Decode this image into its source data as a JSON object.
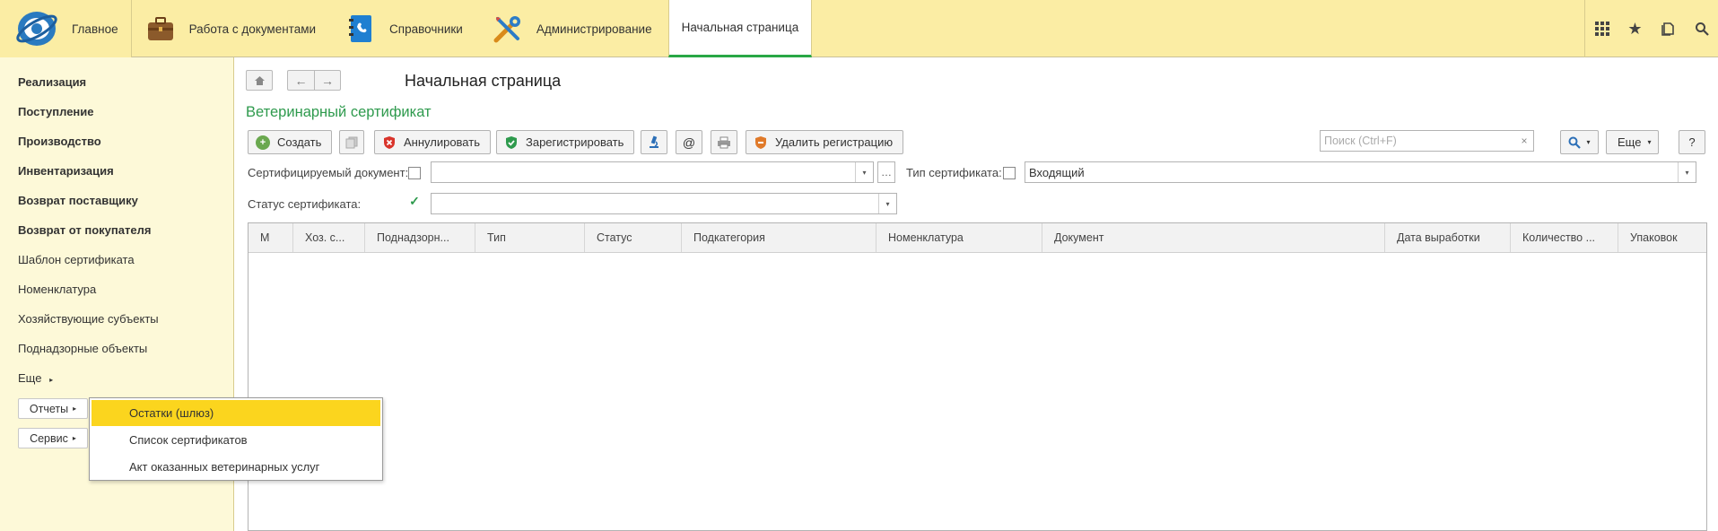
{
  "topbar": {
    "sections": [
      {
        "label": "Главное",
        "icon": "app-logo-icon"
      },
      {
        "label": "Работа с документами",
        "icon": "briefcase-icon"
      },
      {
        "label": "Справочники",
        "icon": "address-book-icon"
      },
      {
        "label": "Администрирование",
        "icon": "tools-icon"
      },
      {
        "label": "Начальная страница",
        "icon": ""
      }
    ],
    "right_icons": [
      "apps-grid-icon",
      "star-icon",
      "history-icon",
      "search-icon"
    ]
  },
  "sidebar": {
    "items": [
      {
        "label": "Реализация",
        "bold": true
      },
      {
        "label": "Поступление",
        "bold": true
      },
      {
        "label": "Производство",
        "bold": true
      },
      {
        "label": "Инвентаризация",
        "bold": true
      },
      {
        "label": "Возврат поставщику",
        "bold": true
      },
      {
        "label": "Возврат от покупателя",
        "bold": true
      },
      {
        "label": "Шаблон сертификата",
        "bold": false
      },
      {
        "label": "Номенклатура",
        "bold": false
      },
      {
        "label": "Хозяйствующие субъекты",
        "bold": false
      },
      {
        "label": "Поднадзорные объекты",
        "bold": false
      },
      {
        "label": "Еще",
        "bold": false
      }
    ],
    "reports_btn": "Отчеты",
    "service_btn": "Сервис"
  },
  "popup": {
    "items": [
      "Остатки (шлюз)",
      "Список сертификатов",
      "Акт оказанных ветеринарных услуг"
    ],
    "selected_index": 0
  },
  "main": {
    "page_title": "Начальная страница",
    "form_title": "Ветеринарный сертификат",
    "toolbar": {
      "create": "Создать",
      "annul": "Аннулировать",
      "register": "Зарегистрировать",
      "delete_registration": "Удалить регистрацию",
      "more": "Еще",
      "help": "?"
    },
    "search": {
      "placeholder": "Поиск (Ctrl+F)",
      "value": ""
    },
    "filters": {
      "cert_doc_label": "Сертифицируемый документ:",
      "cert_doc_checked": false,
      "cert_doc_value": "",
      "cert_type_label": "Тип сертификата:",
      "cert_type_checked": false,
      "cert_type_value": "Входящий",
      "cert_status_label": "Статус сертификата:",
      "cert_status_checked": true,
      "cert_status_value": ""
    },
    "table": {
      "columns": [
        "М",
        "Хоз. с...",
        "Поднадзорн...",
        "Тип",
        "Статус",
        "Подкатегория",
        "Номенклатура",
        "Документ",
        "Дата выработки",
        "Количество ...",
        "Упаковок"
      ],
      "rows": []
    }
  },
  "colors": {
    "topbar_bg": "#fbeda4",
    "sidebar_bg": "#fdf9d8",
    "accent_green": "#2e9a4d",
    "selected_yellow": "#fbd51e"
  }
}
